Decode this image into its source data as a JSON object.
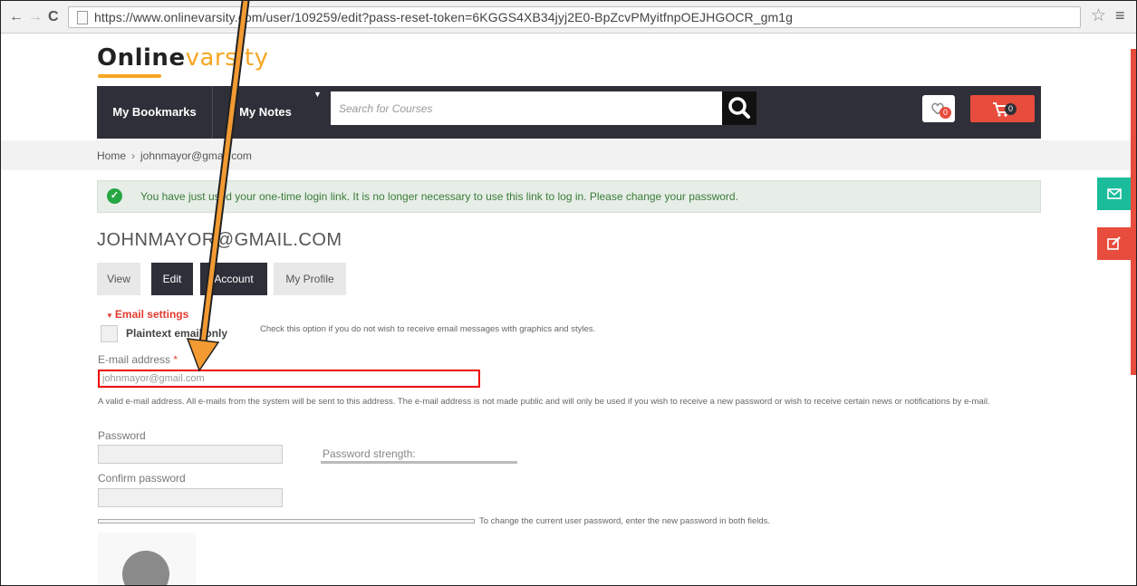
{
  "browser": {
    "url": "https://www.onlinevarsity.com/user/109259/edit?pass-reset-token=6KGGS4XB34jyj2E0-BpZcvPMyitfnpOEJHGOCR_gm1g",
    "back_icon": "←",
    "forward_icon": "→",
    "reload_icon": "C",
    "star_icon": "☆",
    "menu_icon": "≡"
  },
  "logo": {
    "part1": "Online",
    "part2": "varsity"
  },
  "navbar": {
    "bookmarks": "My Bookmarks",
    "notes": "My Notes",
    "search_placeholder": "Search for Courses",
    "wishlist_count": "0",
    "cart_count": "0"
  },
  "breadcrumb": {
    "home": "Home",
    "sep": "›",
    "current": "johnmayor@gmail.com"
  },
  "message": "You have just used your one-time login link. It is no longer necessary to use this link to log in. Please change your password.",
  "user": {
    "title": "JOHNMAYOR@GMAIL.COM"
  },
  "tabs": {
    "view": "View",
    "edit": "Edit",
    "account": "Account",
    "profile": "My Profile"
  },
  "email_settings": {
    "heading": "Email settings",
    "plaintext_label": "Plaintext email only",
    "plaintext_help": "Check this option if you do not wish to receive email messages with graphics and styles."
  },
  "email": {
    "label": "E-mail address",
    "required": "*",
    "value": "johnmayor@gmail.com",
    "help": "A valid e-mail address. All e-mails from the system will be sent to this address. The e-mail address is not made public and will only be used if you wish to receive a new password or wish to receive certain news or notifications by e-mail."
  },
  "password": {
    "label": "Password",
    "strength_label": "Password strength:",
    "confirm_label": "Confirm password",
    "help": "To change the current user password, enter the new password in both fields."
  },
  "colors": {
    "accent_orange": "#f5a623",
    "navbar": "#2e2f38",
    "red": "#e74c3c",
    "teal": "#1abc9c",
    "success_green": "#27a744"
  }
}
